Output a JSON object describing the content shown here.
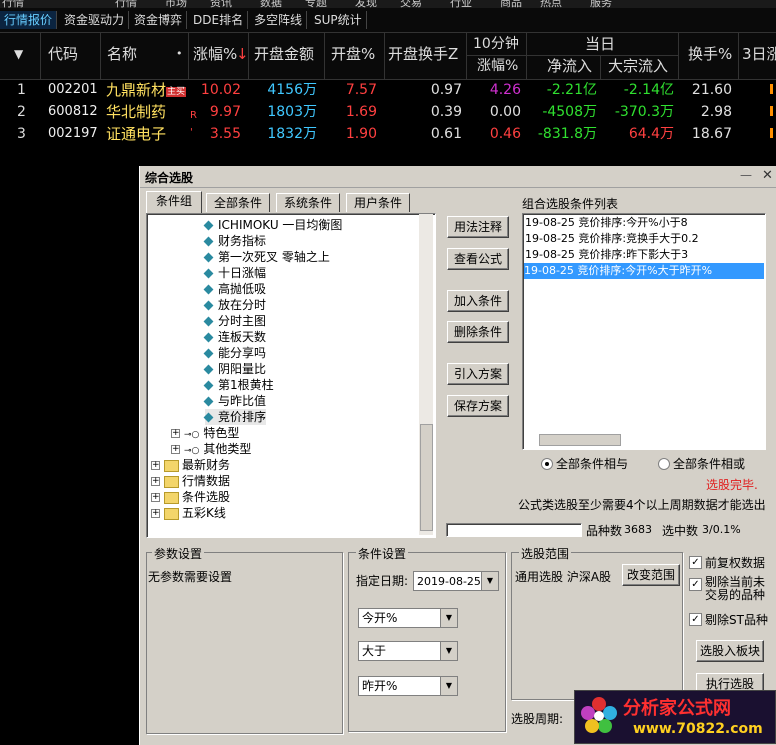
{
  "menubar": {
    "items": [
      "行情",
      "市场",
      "资讯",
      "数据",
      "专题",
      "发现",
      "交易",
      "行业",
      "商品",
      "热点",
      "服务"
    ]
  },
  "tabs": [
    "行情报价",
    "资金驱动力",
    "资金博弈",
    "DDE排名",
    "多空阵线",
    "SUP统计"
  ],
  "header": {
    "dropdown": "▼",
    "code": "代码",
    "name": "名称",
    "dot": "•",
    "change": "涨幅%",
    "arrow": "↓",
    "open_amount": "开盘金额",
    "open_pct": "开盘%",
    "open_turnover": "开盘换手Z",
    "ten_min": "10分钟",
    "ten_min_sub": "涨幅%",
    "today": "当日",
    "net_flow": "净流入",
    "big_flow": "大宗流入",
    "turnover": "换手%",
    "three_day": "3日涨"
  },
  "rows": [
    {
      "idx": "1",
      "code": "002201",
      "name": "九鼎新材",
      "tag": "主买",
      "tag2": "",
      "change": "10.02",
      "amount": "4156万",
      "open_pct": "7.57",
      "open_turn": "0.97",
      "ten": "4.26",
      "net": "-2.21亿",
      "big": "-2.14亿",
      "turn": "21.60",
      "colors": {
        "change": "#ff4040",
        "ten": "#d030d0",
        "net": "#30e030",
        "big": "#30e030"
      }
    },
    {
      "idx": "2",
      "code": "600812",
      "name": "华北制药",
      "tag": "",
      "tag2": "R",
      "change": "9.97",
      "amount": "1803万",
      "open_pct": "1.69",
      "open_turn": "0.39",
      "ten": "0.00",
      "net": "-4508万",
      "big": "-370.3万",
      "turn": "2.98",
      "colors": {
        "change": "#ff4040",
        "ten": "#e0e0e0",
        "net": "#30e030",
        "big": "#30e030"
      }
    },
    {
      "idx": "3",
      "code": "002197",
      "name": "证通电子",
      "tag": "",
      "tag2": "'",
      "change": "3.55",
      "amount": "1832万",
      "open_pct": "1.90",
      "open_turn": "0.61",
      "ten": "0.46",
      "net": "-831.8万",
      "big": "64.4万",
      "turn": "18.67",
      "colors": {
        "change": "#ff4040",
        "ten": "#ff4040",
        "net": "#30e030",
        "big": "#ff4040"
      }
    }
  ],
  "dialog": {
    "title": "综合选股",
    "minimize": "—",
    "close": "✕",
    "tabs": [
      "条件组",
      "全部条件",
      "系统条件",
      "用户条件"
    ],
    "tree_items": [
      "ICHIMOKU 一目均衡图",
      "财务指标",
      "第一次死叉 零轴之上",
      "十日涨幅",
      "高抛低吸",
      "放在分时",
      "分时主图",
      "连板天数",
      "能分享吗",
      "阴阳量比",
      "第1根黄柱",
      "与昨比值",
      "竞价排序"
    ],
    "tree_groups": [
      "特色型",
      "其他类型"
    ],
    "tree_folders": [
      "最新财务",
      "行情数据",
      "条件选股",
      "五彩K线"
    ],
    "buttons": {
      "usage": "用法注释",
      "view_formula": "查看公式",
      "add": "加入条件",
      "delete": "删除条件",
      "import": "引入方案",
      "save": "保存方案",
      "change_range": "改变范围",
      "to_block": "选股入板块",
      "execute": "执行选股"
    },
    "cond_list_title": "组合选股条件列表",
    "cond_list": [
      "19-08-25 竞价排序:今开%小于8",
      "19-08-25 竞价排序:竞换手大于0.2",
      "19-08-25 竞价排序:昨下影大于3",
      "19-08-25 竞价排序:今开%大于昨开%"
    ],
    "radio_and": "全部条件相与",
    "radio_or": "全部条件相或",
    "status_done": "选股完毕.",
    "formula_note": "公式类选股至少需要4个以上周期数据才能选出",
    "count_label": "品种数",
    "count_value": "3683",
    "selected_label": "选中数",
    "selected_value": "3/0.1%",
    "param_title": "参数设置",
    "param_text": "无参数需要设置",
    "cond_title": "条件设置",
    "date_label": "指定日期:",
    "date_value": "2019-08-25",
    "combo1": "今开%",
    "combo2": "大于",
    "combo3": "昨开%",
    "range_title": "选股范围",
    "range_text": "通用选股  沪深A股",
    "chk_fq": "前复权数据",
    "chk_exclude_untraded": "剔除当前未交易的品种",
    "chk_exclude_st": "剔除ST品种",
    "period_label": "选股周期:"
  },
  "watermark": {
    "text": "分析家公式网",
    "url": "www.70822.com"
  }
}
